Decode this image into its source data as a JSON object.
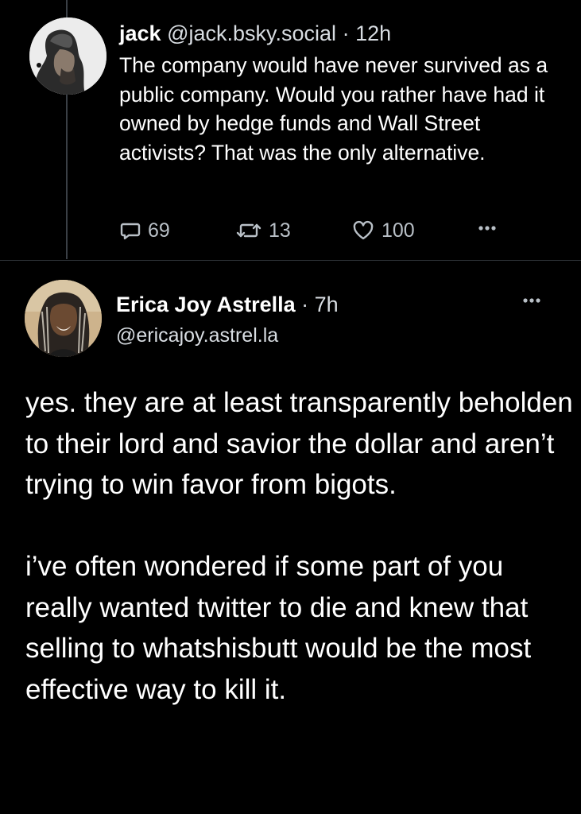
{
  "parent": {
    "author_name": "jack",
    "author_handle": "@jack.bsky.social",
    "separator": "·",
    "time": "12h",
    "text": "The company would have never survived as a public company. Would you rather have had it owned by hedge funds and Wall Street activists? That was the only alternative.",
    "reply_count": "69",
    "repost_count": "13",
    "like_count": "100"
  },
  "post": {
    "author_name": "Erica Joy Astrella",
    "separator": "·",
    "time": "7h",
    "author_handle": "@ericajoy.astrel.la",
    "paragraphs": [
      "yes. they are at least transparently beholden to their lord and savior the dollar and aren’t trying to win favor from bigots.",
      "i’ve often wondered if some part of you really wanted twitter to die and knew that selling to whatshisbutt would be the most effective way to kill it."
    ]
  },
  "icons": {
    "reply": "speech-bubble-icon",
    "repost": "repost-arrows-icon",
    "like": "heart-outline-icon",
    "more": "ellipsis-icon"
  },
  "colors": {
    "background": "#000000",
    "text": "#ffffff",
    "secondary_text": "#d8dde2",
    "action_gray": "#b9c0c7",
    "divider": "#30353a"
  }
}
